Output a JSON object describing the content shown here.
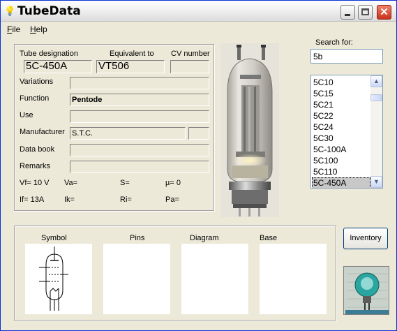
{
  "window": {
    "title": "TubeData"
  },
  "menu": [
    {
      "label": "File"
    },
    {
      "label": "Help"
    }
  ],
  "form": {
    "tube_designation_label": "Tube designation",
    "tube_designation_value": "5C-450A",
    "equivalent_label": "Equivalent to",
    "equivalent_value": "VT506",
    "cv_label": "CV number",
    "cv_value": "",
    "variations_label": "Variations",
    "variations_value": "",
    "function_label": "Function",
    "function_value": "Pentode",
    "use_label": "Use",
    "use_value": "",
    "manufacturer_label": "Manufacturer",
    "manufacturer_value": "S.T.C.",
    "manufacturer_code": "",
    "data_book_label": "Data book",
    "data_book_value": "",
    "remarks_label": "Remarks",
    "remarks_value": "",
    "params": [
      {
        "text": "Vf= 10 V"
      },
      {
        "text": "Va="
      },
      {
        "text": "S="
      },
      {
        "text": "µ=   0"
      },
      {
        "text": "If= 13A"
      },
      {
        "text": "Ik="
      },
      {
        "text": "Ri="
      },
      {
        "text": "Pa="
      }
    ]
  },
  "search": {
    "label": "Search for:",
    "value": "5b",
    "results": [
      "5C10",
      "5C15",
      "5C21",
      "5C22",
      "5C24",
      "5C30",
      "5C-100A",
      "5C100",
      "5C110",
      "5C-450A"
    ],
    "selected": "5C-450A"
  },
  "panels": {
    "symbol_label": "Symbol",
    "pins_label": "Pins",
    "diagram_label": "Diagram",
    "base_label": "Base"
  },
  "buttons": {
    "inventory_label": "Inventory"
  },
  "icons": {
    "app": "lightbulb-icon",
    "minimize": "minimize-icon",
    "maximize": "maximize-icon",
    "close": "close-icon",
    "scroll_up": "scroll-up-icon",
    "scroll_down": "scroll-down-icon"
  },
  "colors": {
    "window_bg": "#ece9d8",
    "title_border": "#0831d9",
    "close_button": "#c8311b",
    "list_selection": "#c8c8c8",
    "input_border": "#7f9db9"
  }
}
